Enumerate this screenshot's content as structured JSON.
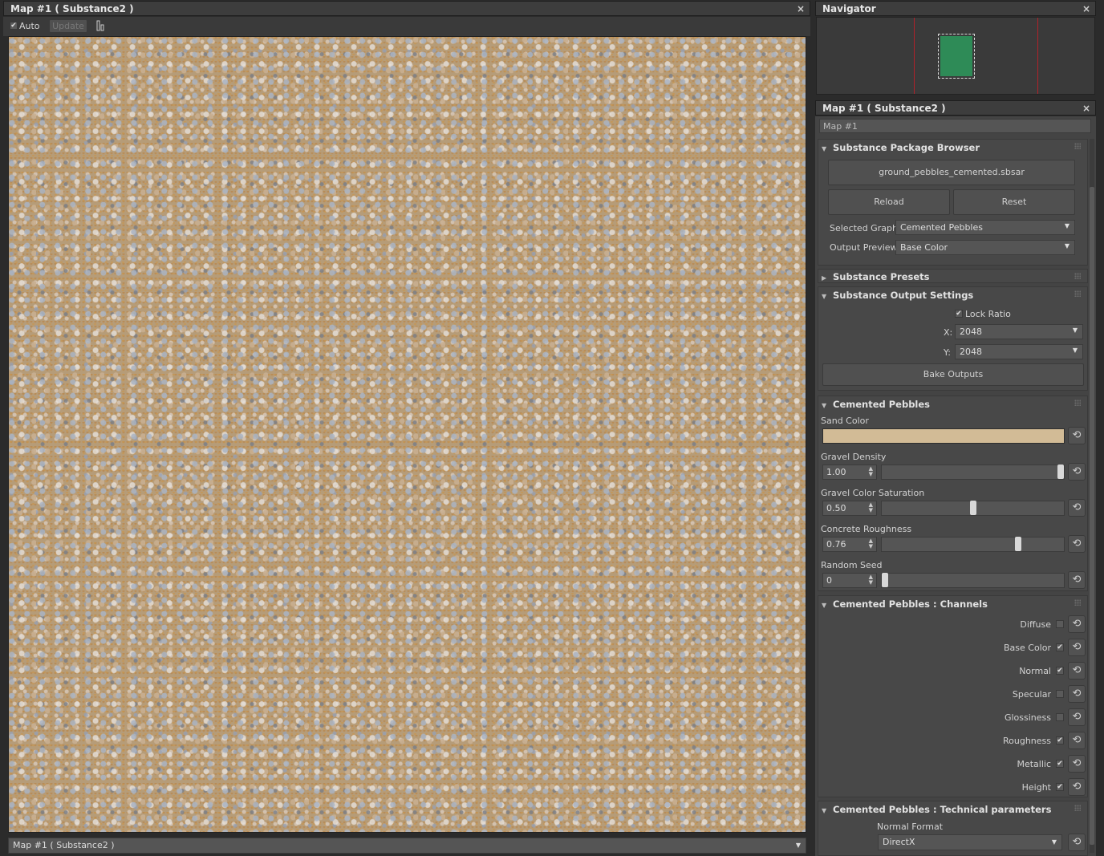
{
  "left_window": {
    "title": "Map #1  ( Substance2 )",
    "close": "×",
    "toolbar": {
      "auto_label": "Auto",
      "auto_checked": true,
      "update_label": "Update"
    },
    "status_combo": "Map #1  ( Substance2 )"
  },
  "navigator": {
    "title": "Navigator",
    "close": "×"
  },
  "editor": {
    "title": "Map #1  ( Substance2 )",
    "close": "×",
    "name_field": "Map #1",
    "package_browser": {
      "title": "Substance Package Browser",
      "file_button": "ground_pebbles_cemented.sbsar",
      "reload": "Reload",
      "reset": "Reset",
      "selected_graph_label": "Selected Graph:",
      "selected_graph_value": "Cemented Pebbles",
      "output_preview_label": "Output Preview:",
      "output_preview_value": "Base Color"
    },
    "presets": {
      "title": "Substance Presets"
    },
    "output_settings": {
      "title": "Substance Output Settings",
      "lock_ratio": "Lock Ratio",
      "x_label": "X:",
      "x_value": "2048",
      "y_label": "Y:",
      "y_value": "2048",
      "bake": "Bake Outputs"
    },
    "graph": {
      "title": "Cemented Pebbles",
      "sand_color_label": "Sand Color",
      "sand_color": "#d2bb96",
      "params": [
        {
          "label": "Gravel Density",
          "value": "1.00",
          "fraction": 1.0
        },
        {
          "label": "Gravel Color Saturation",
          "value": "0.50",
          "fraction": 0.5
        },
        {
          "label": "Concrete Roughness",
          "value": "0.76",
          "fraction": 0.76
        },
        {
          "label": "Random Seed",
          "value": "0",
          "fraction": 0.0
        }
      ]
    },
    "channels": {
      "title": "Cemented Pebbles : Channels",
      "items": [
        {
          "label": "Diffuse",
          "checked": false
        },
        {
          "label": "Base Color",
          "checked": true
        },
        {
          "label": "Normal",
          "checked": true
        },
        {
          "label": "Specular",
          "checked": false
        },
        {
          "label": "Glossiness",
          "checked": false
        },
        {
          "label": "Roughness",
          "checked": true
        },
        {
          "label": "Metallic",
          "checked": true
        },
        {
          "label": "Height",
          "checked": true
        }
      ]
    },
    "technical": {
      "title": "Cemented Pebbles : Technical parameters",
      "normal_format_label": "Normal Format",
      "normal_format_value": "DirectX"
    }
  },
  "icons": {
    "reset": "reset-icon",
    "check": "check-icon",
    "collapse": "triangle-icon"
  }
}
